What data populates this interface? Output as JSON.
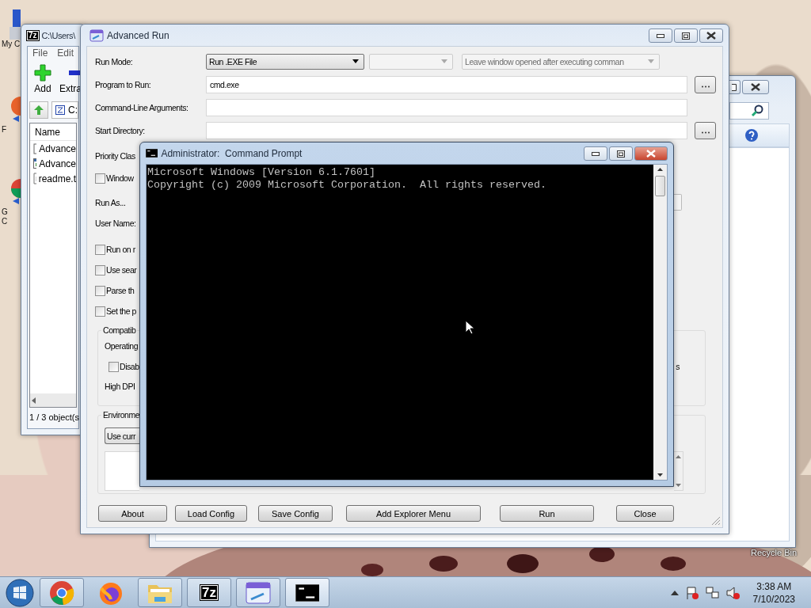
{
  "desktop": {
    "icons": [
      {
        "kind": "computer",
        "lines": [
          "My C"
        ]
      },
      {
        "kind": "firefox",
        "lines": [
          "F"
        ]
      },
      {
        "kind": "chrome",
        "lines": [
          "G",
          "C"
        ]
      }
    ],
    "recycle_bin": {
      "label": "Recycle Bin"
    }
  },
  "sevenzip": {
    "logo": "7z",
    "title": "C:\\Users\\",
    "menu": [
      "File",
      "Edit"
    ],
    "toolbar": [
      {
        "kind": "add",
        "label": "Add"
      },
      {
        "kind": "extract",
        "label": "Extra"
      }
    ],
    "path": "C:",
    "columns": [
      "Name"
    ],
    "files": [
      {
        "kind": "help",
        "name": "Advance"
      },
      {
        "kind": "app",
        "name": "Advance"
      },
      {
        "kind": "text",
        "name": "readme.t"
      }
    ],
    "status": "1 / 3 object(s"
  },
  "advanced_run": {
    "title": "Advanced Run",
    "run_mode": {
      "label": "Run Mode:",
      "value": "Run .EXE File",
      "after_run": "Leave window opened after executing comman"
    },
    "program": {
      "label": "Program to Run:",
      "value": "cmd.exe"
    },
    "arguments": {
      "label": "Command-Line Arguments:"
    },
    "start_directory": {
      "label": "Start Directory:"
    },
    "priority": {
      "label": "Priority Clas"
    },
    "window_check": {
      "label": "Window",
      "checked": false
    },
    "run_as": {
      "label": "Run As..."
    },
    "user_name": {
      "label": "User Name:"
    },
    "options": [
      {
        "label": "Run on r",
        "checked": false
      },
      {
        "label": "Use sear",
        "checked": false
      },
      {
        "label": "Parse th",
        "checked": false
      },
      {
        "label": "Set the p",
        "checked": false
      }
    ],
    "compatibility": {
      "title": "Compatib",
      "os_label": "Operating",
      "disable": {
        "label": "Disab",
        "checked": false
      },
      "tail": "s",
      "dpi_label": "High DPI"
    },
    "environment": {
      "title": "Environme",
      "button": "Use curr"
    },
    "buttons": [
      "About",
      "Load Config",
      "Save Config",
      "Add Explorer Menu",
      "Run",
      "Close"
    ]
  },
  "command_prompt": {
    "title": "Administrator:  Command Prompt",
    "lines": [
      "Microsoft Windows [Version 6.1.7601]",
      "Copyright (c) 2009 Microsoft Corporation.  All rights reserved."
    ]
  },
  "taskbar": {
    "apps": [
      {
        "kind": "chrome",
        "running": true,
        "active": false
      },
      {
        "kind": "firefox",
        "running": false,
        "active": false
      },
      {
        "kind": "explorer",
        "running": true,
        "active": false
      },
      {
        "kind": "sevenzip",
        "logo": "7z",
        "running": true,
        "active": false
      },
      {
        "kind": "advanced_run",
        "running": true,
        "active": false
      },
      {
        "kind": "console",
        "running": true,
        "active": true
      }
    ],
    "clock": {
      "time": "3:38 AM",
      "date": "7/10/2023"
    }
  }
}
